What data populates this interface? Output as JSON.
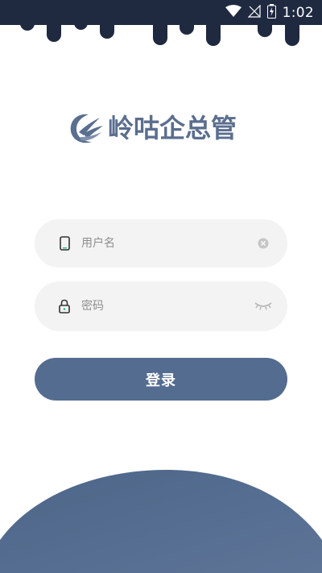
{
  "status_bar": {
    "time": "1:02",
    "icons": [
      "wifi-icon",
      "signal-icon",
      "battery-charging-icon"
    ]
  },
  "app": {
    "logo_text": "岭咕企总管",
    "logo_icon": "bird-wave-logo-icon"
  },
  "login_form": {
    "username": {
      "placeholder": "用户名",
      "value": "",
      "leading_icon": "phone-icon",
      "trailing_icon": "clear-icon"
    },
    "password": {
      "placeholder": "密码",
      "value": "",
      "leading_icon": "lock-icon",
      "trailing_icon": "eye-closed-icon"
    },
    "submit_label": "登录"
  },
  "colors": {
    "primary": "#536c8f",
    "drip": "#1f2a40",
    "field_background": "#f3f3f3",
    "logo": "#5a6e8e"
  }
}
